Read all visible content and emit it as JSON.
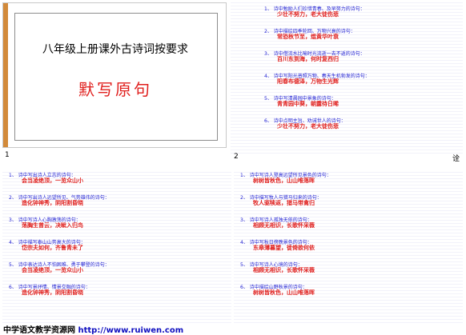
{
  "slide1": {
    "title": "八年级上册课外古诗词按要求",
    "subtitle": "默写原句",
    "number": "1"
  },
  "slide2": {
    "number": "2",
    "sidelabel": "诠",
    "lines": [
      {
        "q": "1、 诗中勉励人们珍惜青春、及早努力的诗句：",
        "a": "少壮不努力，老大徒伤悲"
      },
      {
        "q": "2、 诗中描绘四季轮回、万物兴衰的诗句：",
        "a": "常恐秋节至，焜黄华叶衰"
      },
      {
        "q": "3、 诗中借流水比喻时光流逝一去不返的诗句：",
        "a": "百川东到海，何时复西归"
      },
      {
        "q": "4、 诗中写阳光普照万物、春天生机勃发的诗句：",
        "a": "阳春布德泽，万物生光辉"
      },
      {
        "q": "5、 诗中写清晨园中景象的诗句：",
        "a": "青青园中葵，朝露待日晞"
      },
      {
        "q": "6、 诗中点明主旨、劝诫世人的诗句：",
        "a": "少壮不努力，老大徒伤悲"
      }
    ]
  },
  "slide3": {
    "lines": [
      {
        "q": "1、 诗中写出诗人立志的诗句：",
        "a": "会当凌绝顶，一览众山小"
      },
      {
        "q": "2、 诗中写出诗人远望所见、气势雄伟的诗句：",
        "a": "造化钟神秀，阴阳割昏晓"
      },
      {
        "q": "3、 诗中写诗人心胸激荡的诗句：",
        "a": "荡胸生曾云，决眦入归鸟"
      },
      {
        "q": "4、 诗中描写泰山山势高大的诗句：",
        "a": "岱宗夫如何，齐鲁青未了"
      },
      {
        "q": "5、 诗中表达诗人不怕困难、勇于攀登的诗句：",
        "a": "会当凌绝顶，一览众山小"
      },
      {
        "q": "6、 诗中写景抒情、情景交融的诗句：",
        "a": "造化钟神秀，阴阳割昏晓"
      }
    ]
  },
  "slide4": {
    "lines": [
      {
        "q": "1、 诗中写诗人登高远望所见景色的诗句：",
        "a": "树树皆秋色，山山唯落晖"
      },
      {
        "q": "2、 诗中描写牧人与猎马归来的诗句：",
        "a": "牧人驱犊返，猎马带禽归"
      },
      {
        "q": "3、 诗中写诗人孤独无依的诗句：",
        "a": "相顾无相识，长歌怀采薇"
      },
      {
        "q": "4、 诗中写秋日傍晚景色的诗句：",
        "a": "东皋薄暮望，徙倚欲何依"
      },
      {
        "q": "5、 诗中写诗人心境的诗句：",
        "a": "相顾无相识，长歌怀采薇"
      },
      {
        "q": "6、 诗中描绘山野秋景的诗句：",
        "a": "树树皆秋色，山山唯落晖"
      }
    ]
  },
  "footer": {
    "site": "中学语文教学资源网",
    "url": "http://www.ruiwen.com"
  }
}
